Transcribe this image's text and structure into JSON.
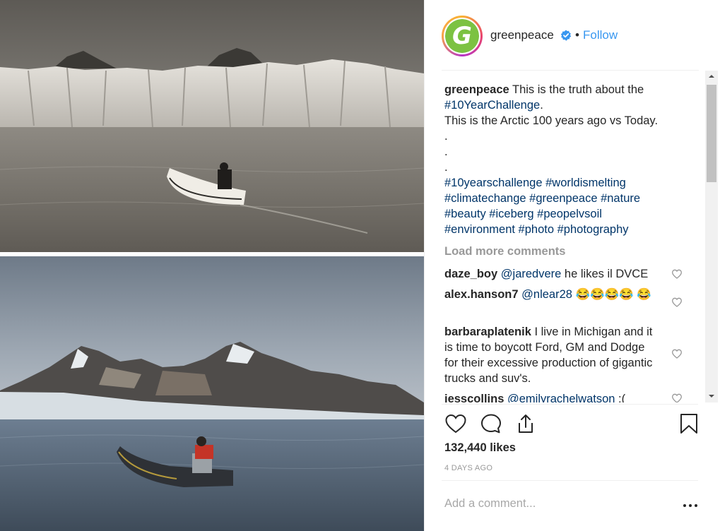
{
  "post": {
    "username": "greenpeace",
    "separator": "•",
    "follow_label": "Follow",
    "avatar_letter": "G",
    "avatar_color": "#7cc242",
    "verified_icon": "verified-badge-icon",
    "caption": {
      "username": "greenpeace",
      "line1_text": "This is the truth about the",
      "line2_tag": "#10YearChallenge",
      "line2_suffix": ".",
      "line3_text": "This is the Arctic 100 years ago vs Today.",
      "dot1": ".",
      "dot2": ".",
      "dot3": ".",
      "tags_line1": "#10yearschallenge #worldismelting",
      "tags_line2": "#climatechange #greenpeace #nature",
      "tags_line3": "#beauty #iceberg #peopelvsoil",
      "tags_line4": "#environment #photo #photography"
    },
    "load_more_label": "Load more comments",
    "comments": [
      {
        "user": "daze_boy",
        "mention": "@jaredvere",
        "text": " he likes il DVCE"
      },
      {
        "user": "alex.hanson7",
        "mention": "@nlear28",
        "text": " 😂😂😂😂 😂"
      },
      {
        "user": "barbaraplatenik",
        "mention": "",
        "text": " I live in Michigan and it is time to boycott Ford, GM and Dodge for their excessive production of gigantic trucks and suv's."
      },
      {
        "user": "jesscollins",
        "mention": "@emilyrachelwatson",
        "text": " :("
      }
    ],
    "likes_label": "132,440 likes",
    "time_label": "4 DAYS AGO",
    "add_comment_placeholder": "Add a comment...",
    "accent_color": "#3897f0"
  }
}
